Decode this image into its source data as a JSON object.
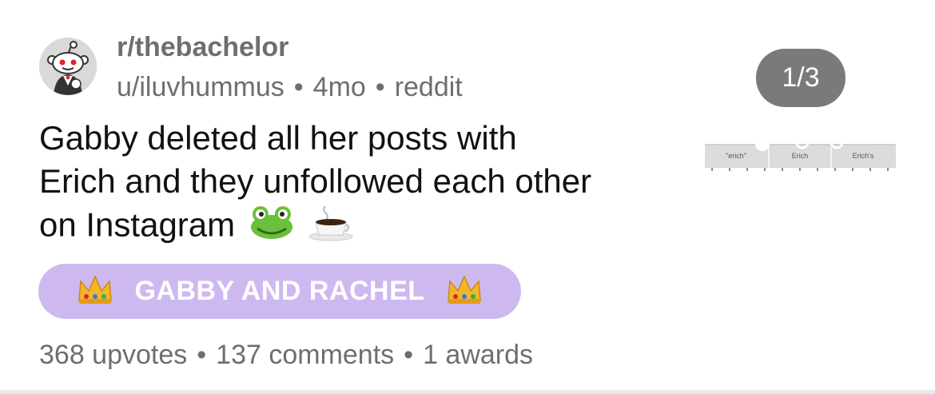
{
  "post": {
    "subreddit": "r/thebachelor",
    "author": "u/iluvhummus",
    "age": "4mo",
    "source": "reddit",
    "separator": "•",
    "title": "Gabby deleted all her posts with Erich and they unfollowed each other on Instagram",
    "title_emojis": [
      "frog-emoji",
      "coffee-emoji"
    ],
    "flair": {
      "text": "GABBY AND RACHEL",
      "background": "#cdb9ef",
      "icon": "crown-icon"
    },
    "stats": {
      "upvotes": "368 upvotes",
      "comments": "137 comments",
      "awards": "1 awards"
    }
  },
  "media": {
    "pager": "1/3",
    "thumb_labels": [
      "\"erich\"",
      "Erich",
      "Erich's"
    ]
  },
  "colors": {
    "meta_gray": "#6e6e6e",
    "pager_bg": "#7a7a7a"
  }
}
